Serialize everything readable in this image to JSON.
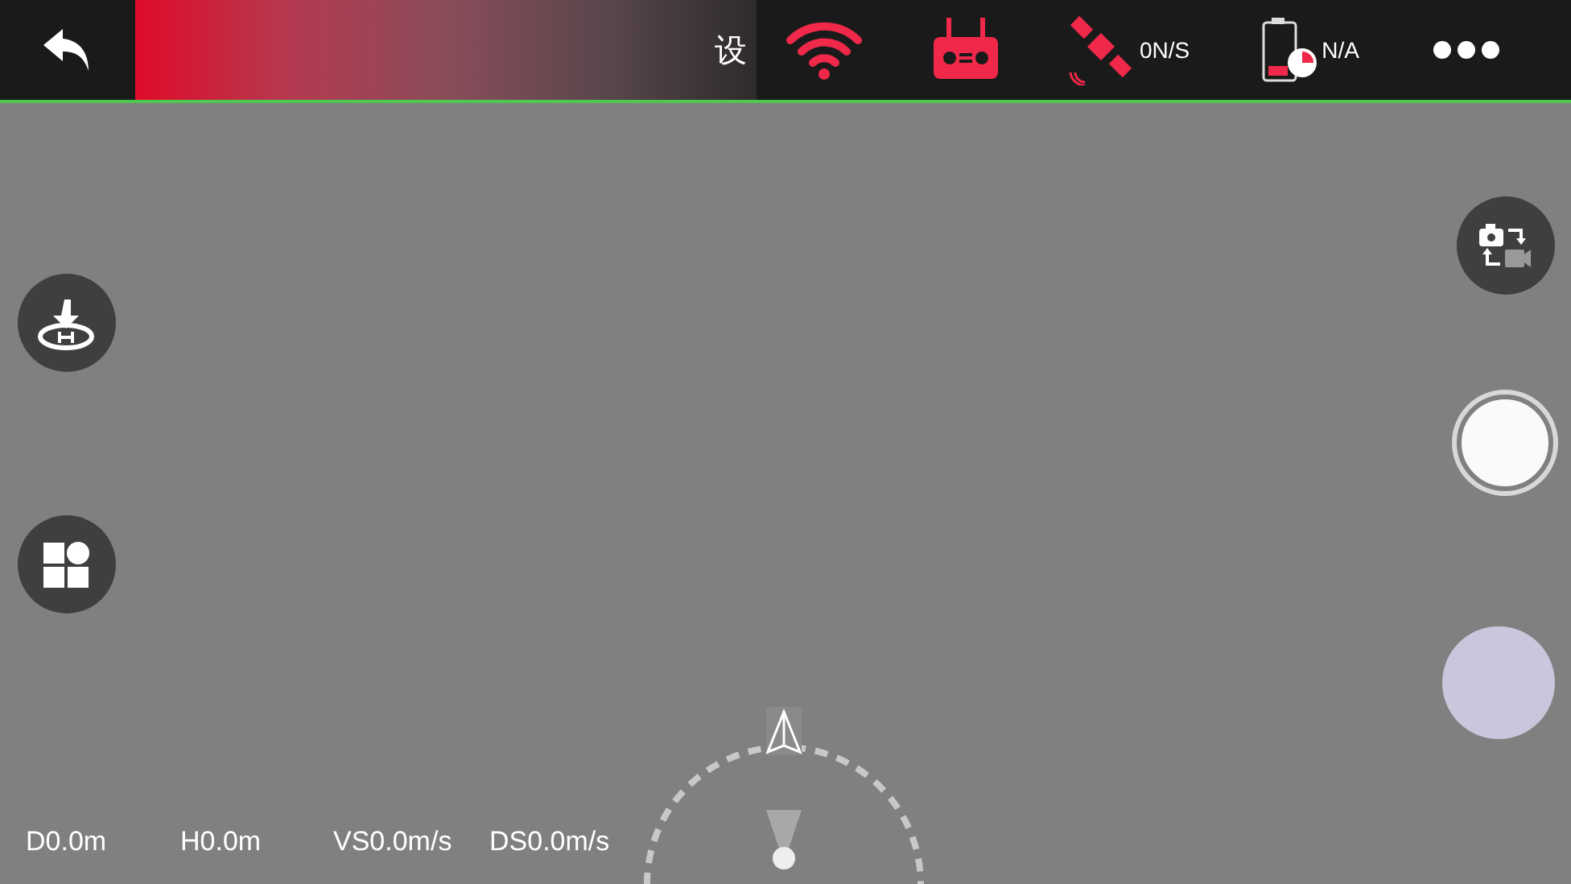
{
  "top_bar": {
    "title": "设",
    "satellites": "0N/S",
    "battery": "N/A"
  },
  "telemetry": [
    {
      "text": "D0.0m"
    },
    {
      "text": "H0.0m"
    },
    {
      "text": "VS0.0m/s"
    },
    {
      "text": "DS0.0m/s"
    }
  ]
}
